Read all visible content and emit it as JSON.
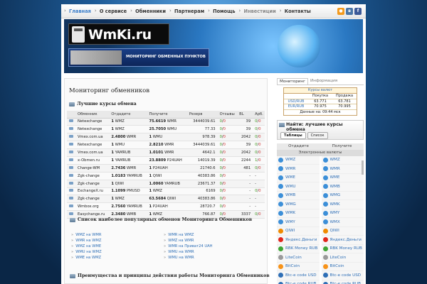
{
  "nav": {
    "items": [
      "Главная",
      "О сервисе",
      "Обменники",
      "Партнерам",
      "Помощь",
      "Инвестиции",
      "Контакты"
    ]
  },
  "header": {
    "logo": "WmKi.ru",
    "banner": "МОНИТОРИНГ ОБМЕННЫХ ПУНКТОВ"
  },
  "main": {
    "title": "Мониторинг обменников",
    "best_title": "Лучшие курсы обмена",
    "columns": [
      "Обменник",
      "Отдадите",
      "Получите",
      "Резерв",
      "Отзывы",
      "BL",
      "Арб."
    ],
    "rows": [
      {
        "name": "Netexchange",
        "give": "1",
        "give_cur": "WMZ",
        "get": "75.6619",
        "get_cur": "WMR",
        "reserve": "3444039.61",
        "rev": "0/0",
        "bl": "39",
        "arb": "0/0"
      },
      {
        "name": "Netexchange",
        "give": "1",
        "give_cur": "WMZ",
        "get": "25.7050",
        "get_cur": "WMU",
        "reserve": "77.33",
        "rev": "0/0",
        "bl": "39",
        "arb": "0/0"
      },
      {
        "name": "Vmex.com.ua",
        "give": "2.4800",
        "give_cur": "WMR",
        "get": "1",
        "get_cur": "WMU",
        "reserve": "978.39",
        "rev": "0/0",
        "bl": "2042",
        "arb": "0/0"
      },
      {
        "name": "Netexchange",
        "give": "1",
        "give_cur": "WMU",
        "get": "2.8210",
        "get_cur": "WMR",
        "reserve": "3444039.61",
        "rev": "0/0",
        "bl": "39",
        "arb": "0/0"
      },
      {
        "name": "Vmex.com.ua",
        "give": "1",
        "give_cur": "YAMRUB",
        "get": "1.0101",
        "get_cur": "WMR",
        "reserve": "4642.1",
        "rev": "0/0",
        "bl": "2042",
        "arb": "0/0"
      },
      {
        "name": "x-Obmen.ru",
        "give": "1",
        "give_cur": "YAMRUB",
        "get": "23.8809",
        "get_cur": "P24UAH",
        "reserve": "14019.39",
        "rev": "0/0",
        "bl": "2244",
        "arb": "1/0"
      },
      {
        "name": "Change-WM",
        "give": "2.7436",
        "give_cur": "WMR",
        "get": "1",
        "get_cur": "P24UAH",
        "reserve": "21740.6",
        "rev": "0/0",
        "bl": "481",
        "arb": "0/0"
      },
      {
        "name": "Zgk-change",
        "give": "1.0183",
        "give_cur": "YAMRUB",
        "get": "1",
        "get_cur": "QIWI",
        "reserve": "40383.86",
        "rev": "0/0",
        "bl": "-",
        "arb": "-"
      },
      {
        "name": "Zgk-change",
        "give": "1",
        "give_cur": "QIWI",
        "get": "1.0060",
        "get_cur": "YAMRUB",
        "reserve": "23671.37",
        "rev": "0/0",
        "bl": "-",
        "arb": "-"
      },
      {
        "name": "ExchangeX.ru",
        "give": "1.1099",
        "give_cur": "PMUSD",
        "get": "1",
        "get_cur": "WMZ",
        "reserve": "6169",
        "rev": "0/0",
        "bl": "-",
        "arb": "0/0"
      },
      {
        "name": "Zgk-change",
        "give": "1",
        "give_cur": "WMZ",
        "get": "63.5684",
        "get_cur": "QIWI",
        "reserve": "40383.86",
        "rev": "0/0",
        "bl": "-",
        "arb": "-"
      },
      {
        "name": "Wmbox.org",
        "give": "2.7560",
        "give_cur": "YAMRUB",
        "get": "1",
        "get_cur": "P24UAH",
        "reserve": "28720.7",
        "rev": "0/0",
        "bl": "-",
        "arb": "-"
      },
      {
        "name": "Easychange.ru",
        "give": "2.3480",
        "give_cur": "WMB",
        "get": "1",
        "get_cur": "WMZ",
        "reserve": "766.87",
        "rev": "0/0",
        "bl": "3337",
        "arb": "0/0"
      }
    ],
    "popular_title": "Список наиболее популярных обменов Мониторинга Обменников",
    "popular": [
      "WMZ на WMR",
      "WMR на WMZ",
      "WMR на WMZ",
      "WMZ на WMR",
      "WMZ на WME",
      "WMR на Приват24 UAH",
      "WMU на WMZ",
      "WMU на WMR",
      "WME на WMZ",
      "WMU на WMR"
    ],
    "adv_title": "Преимущества и принципы действия работы Мониторинга Обменников"
  },
  "sidebar": {
    "tabs": [
      "Мониторинг",
      "Информация"
    ],
    "rates": {
      "title": "Курсы валют",
      "cols": [
        "",
        "Покупка",
        "Продажа"
      ],
      "rows": [
        [
          "USD/RUB",
          "63.771",
          "63.781"
        ],
        [
          "EUR/RUB",
          "70.975",
          "70.995"
        ]
      ],
      "footer": "Данные на: 09:44 мск"
    },
    "find": {
      "title": "Найти: лучшие курсы обмена",
      "tab1": "Таблицы",
      "tab2": "Список"
    },
    "give_label": "Отдадите",
    "get_label": "Получите",
    "sub_label": "Электронные валюты",
    "currencies": [
      {
        "left": "WMZ",
        "right": "WMZ",
        "color": "#3c8fd8"
      },
      {
        "left": "WMR",
        "right": "WMR",
        "color": "#3c8fd8"
      },
      {
        "left": "WME",
        "right": "WME",
        "color": "#3c8fd8"
      },
      {
        "left": "WMU",
        "right": "WMB",
        "color": "#3c8fd8"
      },
      {
        "left": "WMB",
        "right": "WMG",
        "color": "#3c8fd8"
      },
      {
        "left": "WMG",
        "right": "WMK",
        "color": "#3c8fd8"
      },
      {
        "left": "WMK",
        "right": "WMY",
        "color": "#3c8fd8"
      },
      {
        "left": "WMY",
        "right": "WMX",
        "color": "#3c8fd8"
      },
      {
        "left": "QIWI",
        "right": "QIWI",
        "color": "#f08a00"
      },
      {
        "left": "Яндекс.Деньги",
        "right": "Яндекс.Деньги",
        "color": "#e1261c"
      },
      {
        "left": "RBK Money RUB",
        "right": "RBK Money RUB",
        "color": "#3fa535"
      },
      {
        "left": "LiteCoin",
        "right": "LiteCoin",
        "color": "#9a9a9a"
      },
      {
        "left": "BitCoin",
        "right": "BitCoin",
        "color": "#f7931a"
      },
      {
        "left": "Btc-e code USD",
        "right": "Btc-e code USD",
        "color": "#2f6fb6"
      },
      {
        "left": "Btc-e code RUB",
        "right": "Btc-e code RUB",
        "color": "#2f6fb6"
      }
    ]
  }
}
